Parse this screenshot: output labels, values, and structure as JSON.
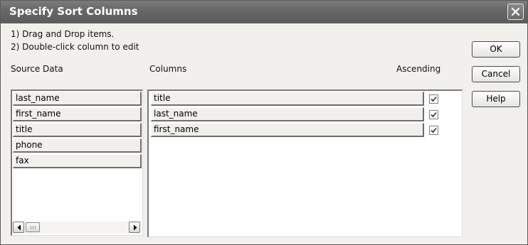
{
  "dialog": {
    "title": "Specify Sort Columns"
  },
  "instructions": [
    "1) Drag and Drop items.",
    "2) Double-click column to edit"
  ],
  "source": {
    "label": "Source Data",
    "items": [
      "last_name",
      "first_name",
      "title",
      "phone",
      "fax"
    ]
  },
  "columns": {
    "label": "Columns",
    "ascending_label": "Ascending",
    "items": [
      {
        "name": "title",
        "ascending": true
      },
      {
        "name": "last_name",
        "ascending": true
      },
      {
        "name": "first_name",
        "ascending": true
      }
    ]
  },
  "buttons": {
    "ok": "OK",
    "cancel": "Cancel",
    "help": "Help"
  },
  "icons": {
    "close": "close-icon",
    "check": "checkmark-icon",
    "scroll_left": "arrow-left-icon",
    "scroll_right": "arrow-right-icon"
  }
}
